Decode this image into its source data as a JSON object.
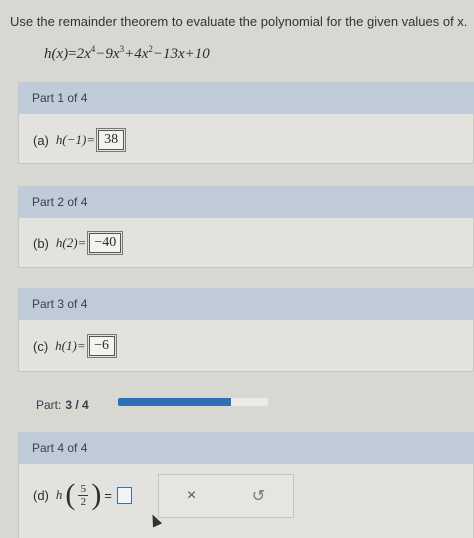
{
  "instructions": "Use the remainder theorem to evaluate the polynomial for the given values of x.",
  "polynomial": {
    "lhs": "h(x)",
    "c1": "2x",
    "e1": "4",
    "c2": "−9x",
    "e2": "3",
    "c3": "+4x",
    "e3": "2",
    "rest": "−13x+10"
  },
  "parts": [
    {
      "header": "Part 1 of 4",
      "label": "(a)",
      "expr": "h(−1)=",
      "answer": "38"
    },
    {
      "header": "Part 2 of 4",
      "label": "(b)",
      "expr": "h(2)=",
      "answer": "−40"
    },
    {
      "header": "Part 3 of 4",
      "label": "(c)",
      "expr": "h(1)=",
      "answer": "−6"
    },
    {
      "header": "Part 4 of 4",
      "label": "(d)",
      "expr_fn": "h",
      "frac_num": "5",
      "frac_den": "2",
      "equals": "="
    }
  ],
  "progress": {
    "label": "Part:",
    "value": "3 / 4",
    "fraction": 0.75,
    "color": "#2f6fb8"
  },
  "tools": {
    "clear_glyph": "×",
    "undo_glyph": "↺"
  }
}
